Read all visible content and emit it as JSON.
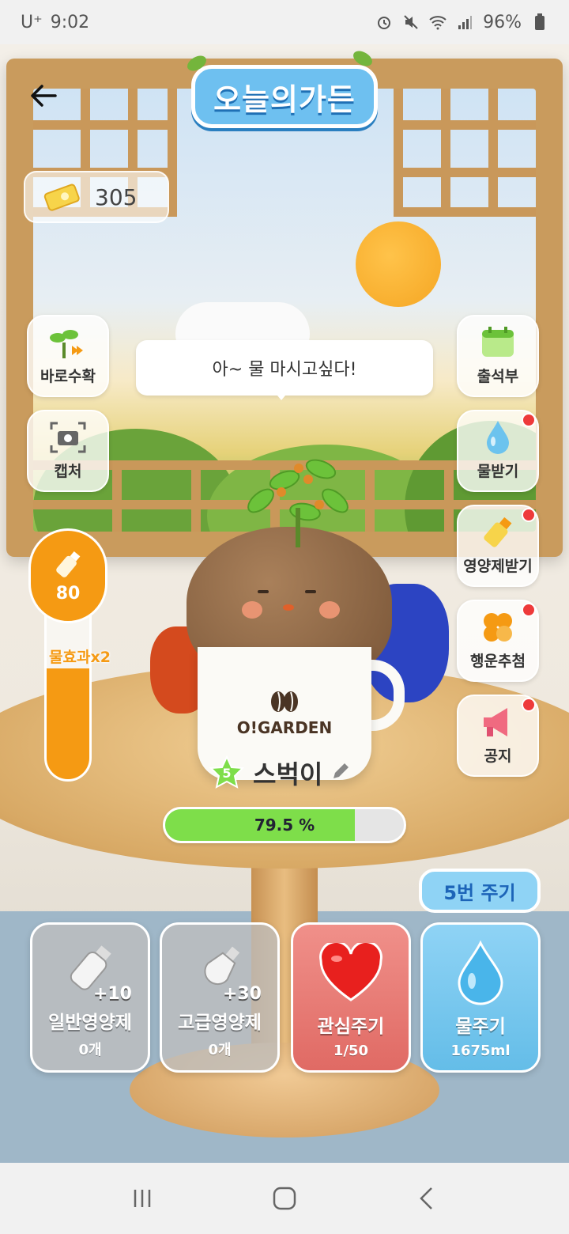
{
  "status_bar": {
    "carrier": "U⁺",
    "time": "9:02",
    "battery": "96%"
  },
  "app": {
    "title": "오늘의가든"
  },
  "coins": {
    "value": "305"
  },
  "left_buttons": [
    {
      "label": "바로수확",
      "icon": "sprout-icon"
    },
    {
      "label": "캡처",
      "icon": "camera-icon"
    }
  ],
  "right_buttons": [
    {
      "label": "출석부",
      "icon": "calendar-icon",
      "badge": false
    },
    {
      "label": "물받기",
      "icon": "water-drop-icon",
      "badge": true
    },
    {
      "label": "영양제받기",
      "icon": "nutrient-icon",
      "badge": true
    },
    {
      "label": "행운추첨",
      "icon": "clover-icon",
      "badge": true
    },
    {
      "label": "공지",
      "icon": "megaphone-icon",
      "badge": true
    }
  ],
  "speech": {
    "text": "아~ 물 마시고싶다!"
  },
  "gauge": {
    "value": "80",
    "effect_label": "물효과x2",
    "fill_fraction": 0.6
  },
  "pot": {
    "brand": "O!GARDEN"
  },
  "plant": {
    "level": "5",
    "name": "스벅이",
    "progress_text": "79.5 %",
    "progress_value": 79.5
  },
  "cycle": {
    "label": "5번 주기"
  },
  "actions": [
    {
      "title": "일반영양제",
      "sub": "0개",
      "plus": "+10",
      "icon": "bottle-icon"
    },
    {
      "title": "고급영양제",
      "sub": "0개",
      "plus": "+30",
      "icon": "premium-bottle-icon"
    },
    {
      "title": "관심주기",
      "sub": "1/50",
      "icon": "heart-icon"
    },
    {
      "title": "물주기",
      "sub": "1675ml",
      "icon": "water-drop-icon"
    }
  ],
  "colors": {
    "accent_orange": "#f59a13",
    "progress_green": "#7ede4a",
    "water_blue": "#64bde8",
    "heart_red": "#e06a64"
  }
}
